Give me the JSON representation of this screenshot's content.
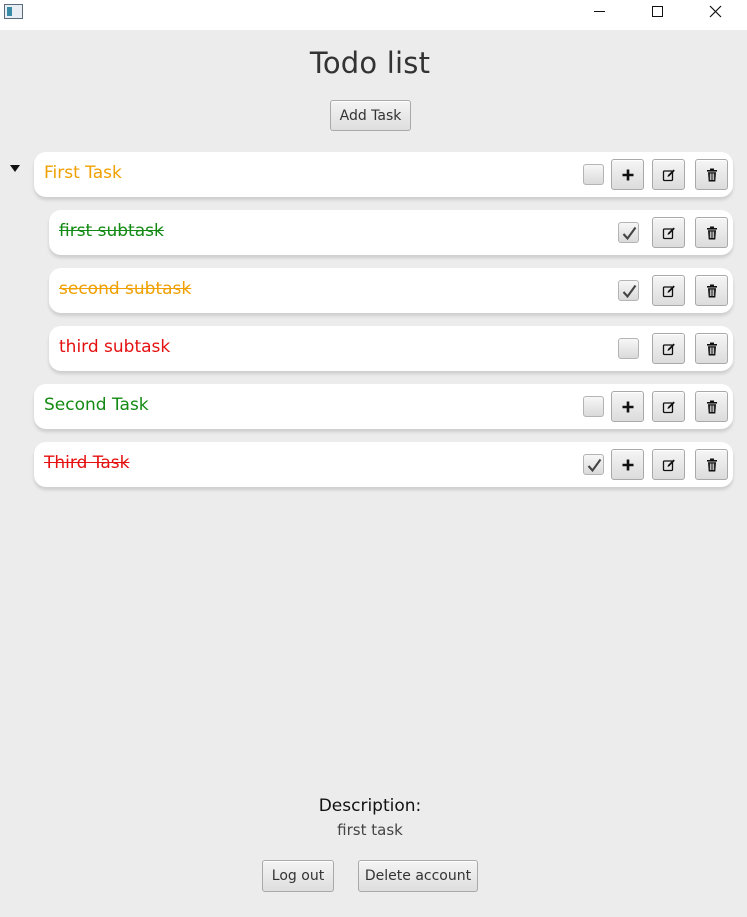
{
  "window": {
    "title": "",
    "controls": [
      "minimize",
      "maximize",
      "close"
    ]
  },
  "header": {
    "title": "Todo list",
    "add_task_label": "Add Task"
  },
  "colors": {
    "orange": "#f0a000",
    "green": "#138a13",
    "red": "#e51010"
  },
  "tasks": [
    {
      "label": "First Task",
      "color": "orange",
      "completed": false,
      "expanded": true,
      "level": 0
    },
    {
      "label": "first subtask",
      "color": "green",
      "completed": true,
      "level": 1
    },
    {
      "label": "second subtask",
      "color": "orange",
      "completed": true,
      "level": 1
    },
    {
      "label": "third subtask",
      "color": "red",
      "completed": false,
      "level": 1
    },
    {
      "label": "Second Task",
      "color": "green",
      "completed": false,
      "level": 0
    },
    {
      "label": "Third Task",
      "color": "red",
      "completed": true,
      "level": 0
    }
  ],
  "icons": {
    "add": "plus-icon",
    "edit": "edit-icon",
    "delete": "trash-icon",
    "check": "checkmark-icon"
  },
  "description": {
    "title": "Description:",
    "text": "first task"
  },
  "footer": {
    "logout_label": "Log out",
    "delete_account_label": "Delete account"
  }
}
